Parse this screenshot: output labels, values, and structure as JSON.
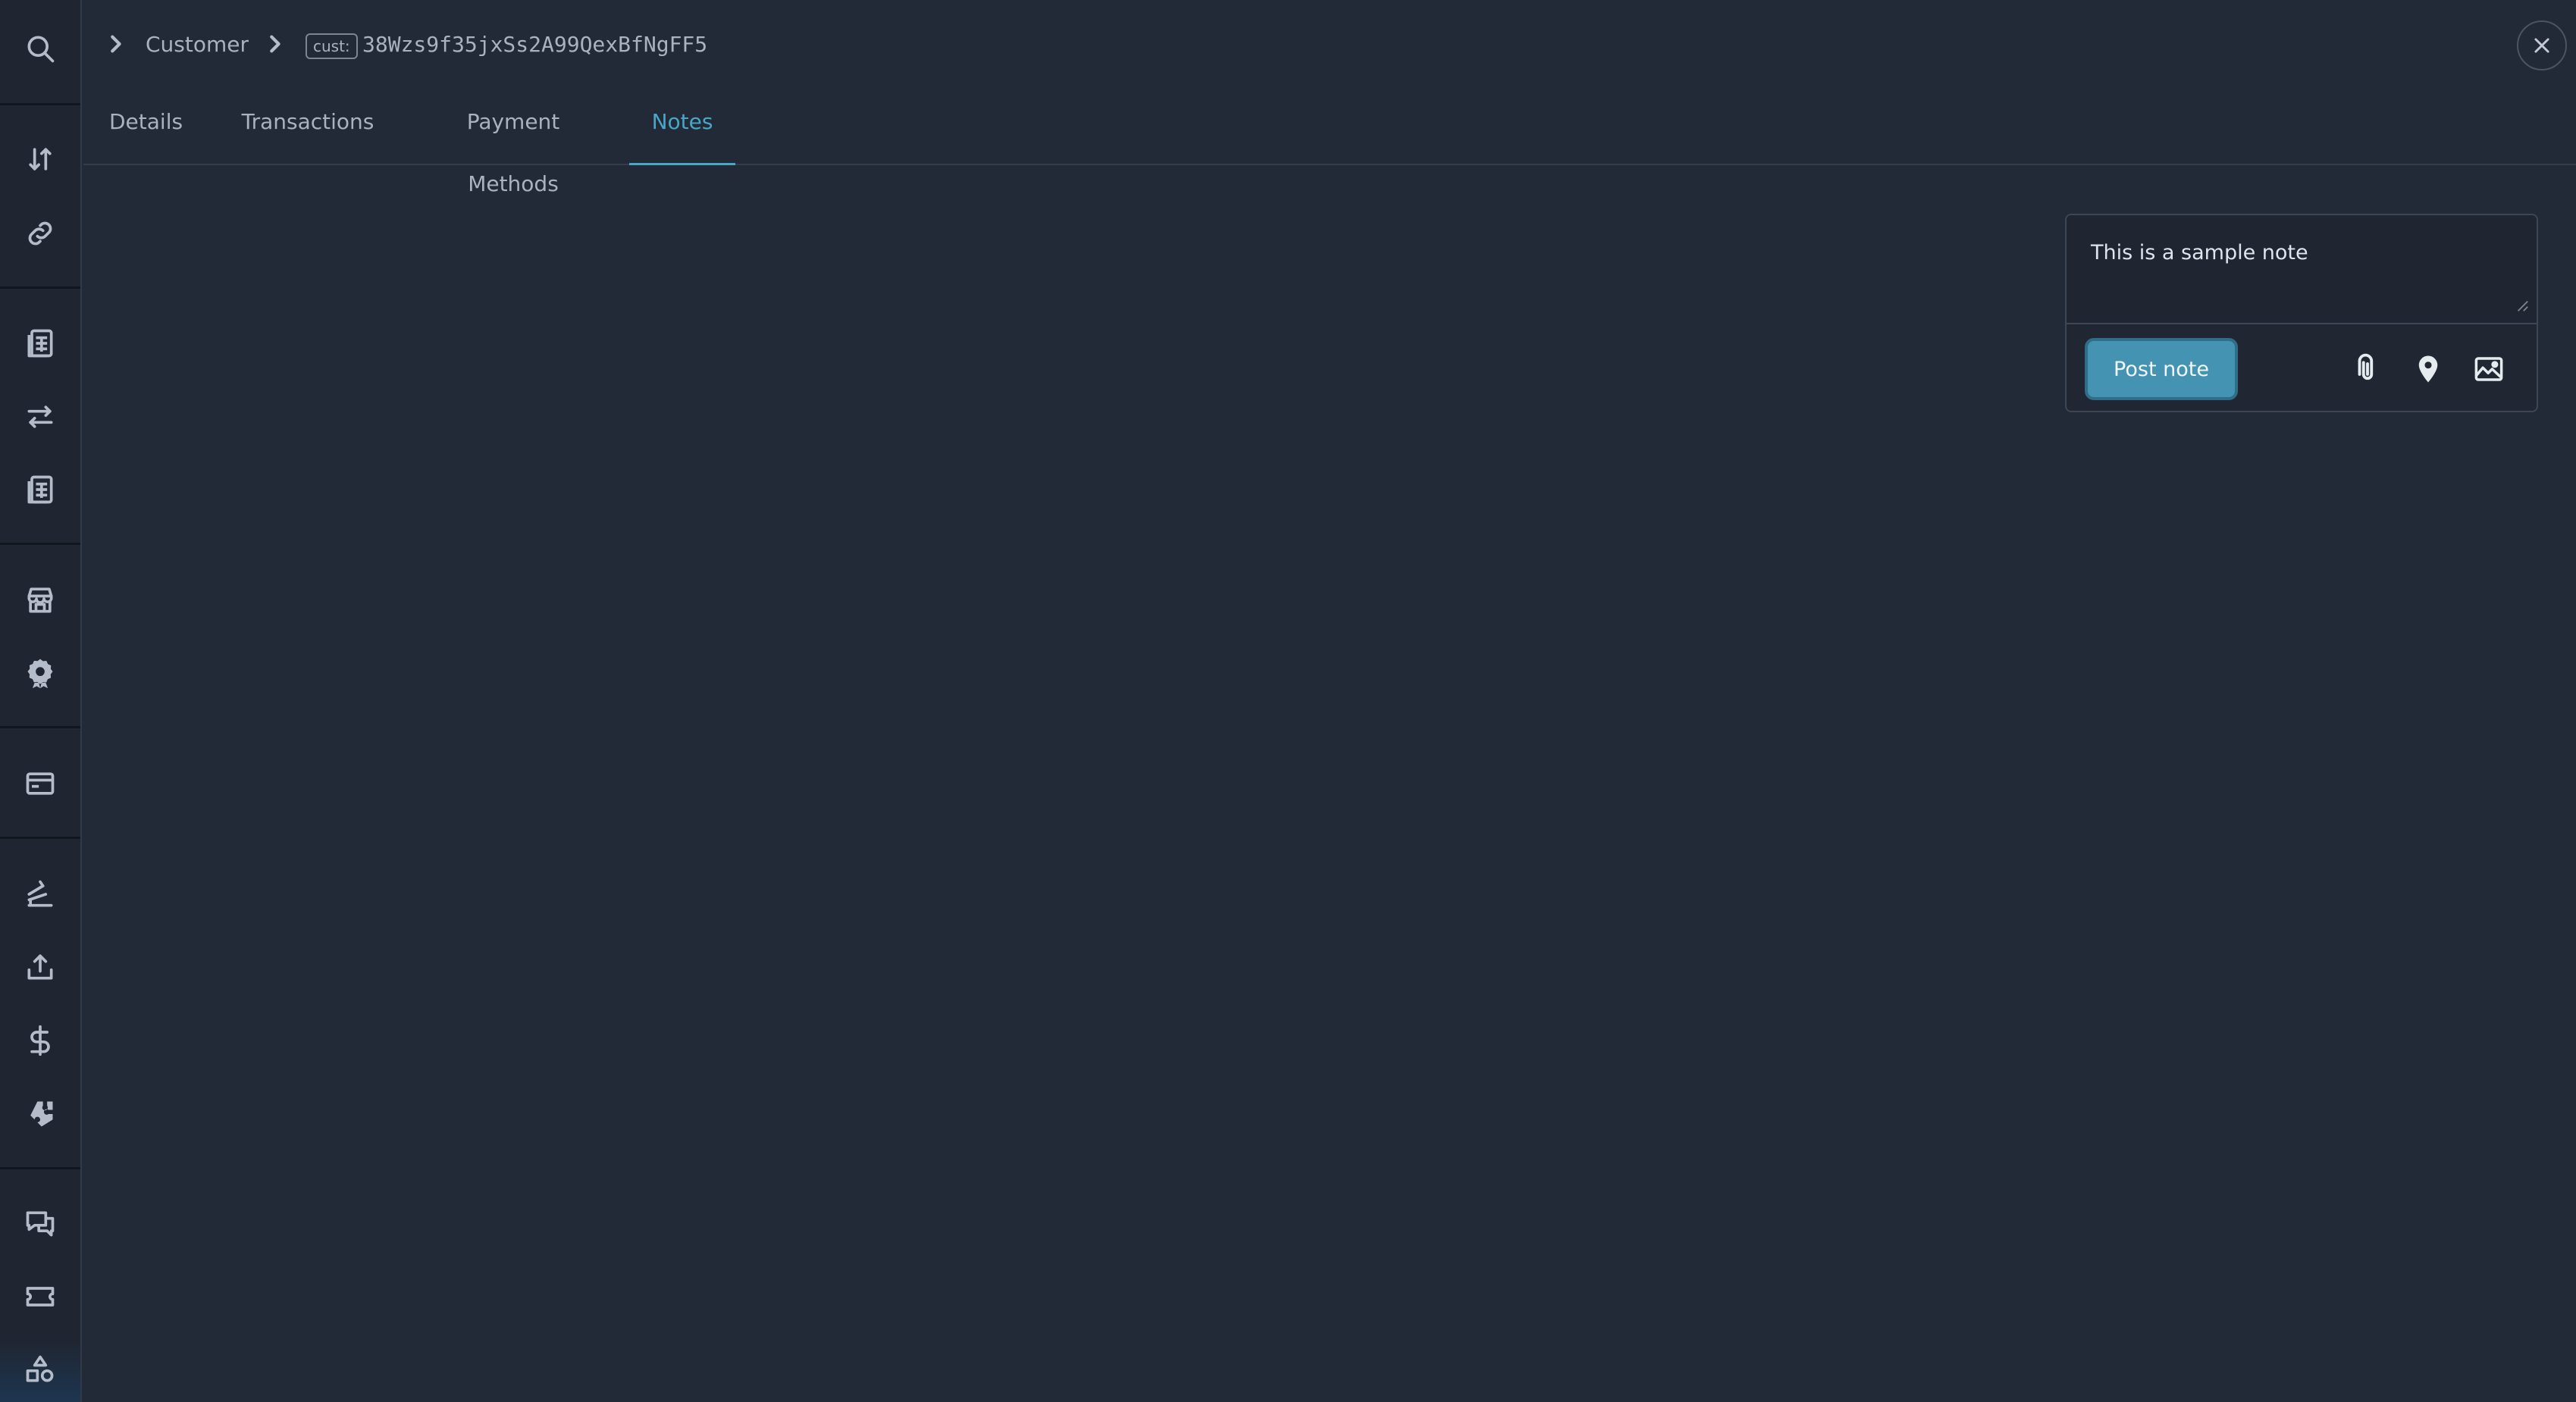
{
  "sidebar": {
    "icons": [
      "search-icon",
      "arrows-up-down-icon",
      "link-icon",
      "ledger-icon",
      "exchange-arrows-icon",
      "ledger-alt-icon",
      "store-icon",
      "badge-icon",
      "credit-card-icon",
      "stack-icon",
      "upload-icon",
      "dollar-icon",
      "puzzle-icon",
      "chat-icon",
      "ticket-icon",
      "shapes-icon"
    ]
  },
  "breadcrumb": {
    "parent_label": "Customer",
    "tag_label": "cust:",
    "id_value": "38Wzs9f35jxSs2A99QexBfNgFF5"
  },
  "tabs": [
    {
      "label": "Details",
      "active": false
    },
    {
      "label": "Transactions",
      "active": false
    },
    {
      "label": "Payment Methods",
      "active": false
    },
    {
      "label": "Notes",
      "active": true
    }
  ],
  "composer": {
    "note_value": "This is a sample note",
    "post_label": "Post note",
    "tool_icons": [
      "paperclip-icon",
      "location-pin-icon",
      "image-icon"
    ]
  },
  "colors": {
    "background": "#222a37",
    "sidebar_bg": "#1f2632",
    "accent": "#49a6c6",
    "button_bg": "#4493b3",
    "text_muted": "#a9b2be"
  }
}
